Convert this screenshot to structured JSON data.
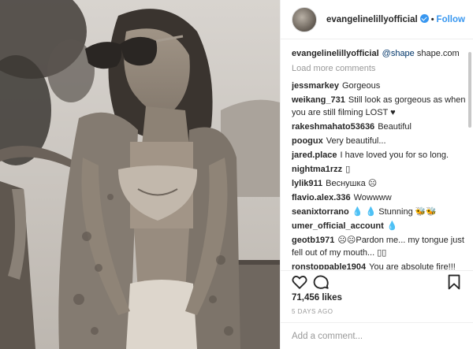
{
  "post": {
    "username": "evangelinelillyofficial",
    "follow_label": "Follow",
    "separator": "•"
  },
  "caption": {
    "user": "evangelinelillyofficial",
    "mention": "@shape",
    "text": "shape.com"
  },
  "load_more": "Load more comments",
  "comments": [
    {
      "user": "jessmarkey",
      "text": "Gorgeous"
    },
    {
      "user": "weikang_731",
      "text": "Still look as gorgeous as when you are still filming LOST ♥"
    },
    {
      "user": "rakeshmahato53636",
      "text": "Beautiful"
    },
    {
      "user": "poogux",
      "text": "Very beautiful..."
    },
    {
      "user": "jared.place",
      "text": "I have loved you for so long."
    },
    {
      "user": "nightma1rzz",
      "text": "▯"
    },
    {
      "user": "lylik911",
      "text": "Веснушка ☹"
    },
    {
      "user": "flavio.alex.336",
      "text": "Wowwww"
    },
    {
      "user": "seanixtorrano",
      "text": "💧 💧 Stunning 🐝🐝"
    },
    {
      "user": "umer_official_account",
      "text": "💧"
    },
    {
      "user": "geotb1971",
      "text": "☹☹Pardon me... my tongue just fell out of my mouth... ▯▯"
    },
    {
      "user": "ronstoppable1904",
      "text": "You are absolute fire!!!"
    }
  ],
  "likes": "71,456 likes",
  "time_ago": "5 DAYS AGO",
  "comment_input": {
    "placeholder": "Add a comment..."
  },
  "icons": {
    "like": "heart-icon",
    "comment": "comment-bubble-icon",
    "save": "bookmark-icon",
    "verified": "verified-badge-icon"
  },
  "colors": {
    "accent": "#3897f0",
    "text": "#262626",
    "muted": "#999999"
  }
}
